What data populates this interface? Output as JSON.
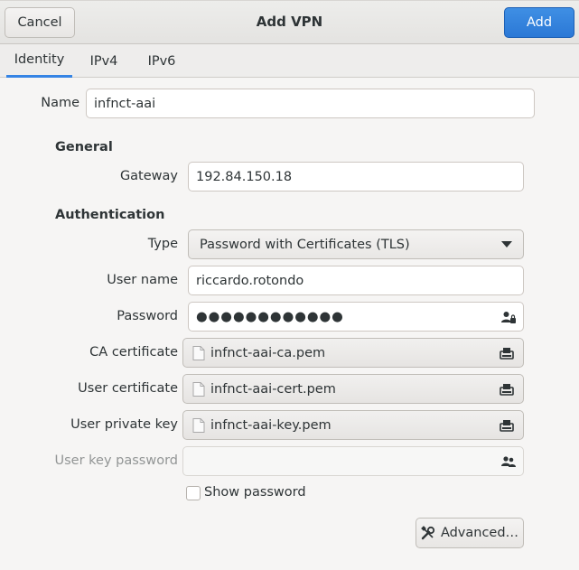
{
  "header": {
    "title": "Add VPN",
    "cancel_label": "Cancel",
    "add_label": "Add",
    "accent_color": "#3584e4"
  },
  "tabs": [
    {
      "label": "Identity",
      "active": true
    },
    {
      "label": "IPv4",
      "active": false
    },
    {
      "label": "IPv6",
      "active": false
    }
  ],
  "identity": {
    "name_label": "Name",
    "name_value": "infnct-aai"
  },
  "general": {
    "heading": "General",
    "gateway_label": "Gateway",
    "gateway_value": "192.84.150.18"
  },
  "authentication": {
    "heading": "Authentication",
    "type_label": "Type",
    "type_value": "Password with Certificates (TLS)",
    "username_label": "User name",
    "username_value": "riccardo.rotondo",
    "password_label": "Password",
    "password_value": "●●●●●●●●●●●●",
    "ca_label": "CA certificate",
    "ca_file": "infnct-aai-ca.pem",
    "usercert_label": "User certificate",
    "usercert_file": "infnct-aai-cert.pem",
    "userkey_label": "User private key",
    "userkey_file": "infnct-aai-key.pem",
    "keypass_label": "User key password",
    "keypass_value": "",
    "show_password_label": "Show password",
    "show_password_checked": false,
    "advanced_label": "Advanced…"
  },
  "icons": {
    "password_storage": "user-lock-icon",
    "keypass_storage": "users-icon",
    "file": "document-icon",
    "file_chooser": "folder-browse-icon",
    "dropdown": "chevron-down-icon",
    "advanced": "tools-icon"
  }
}
